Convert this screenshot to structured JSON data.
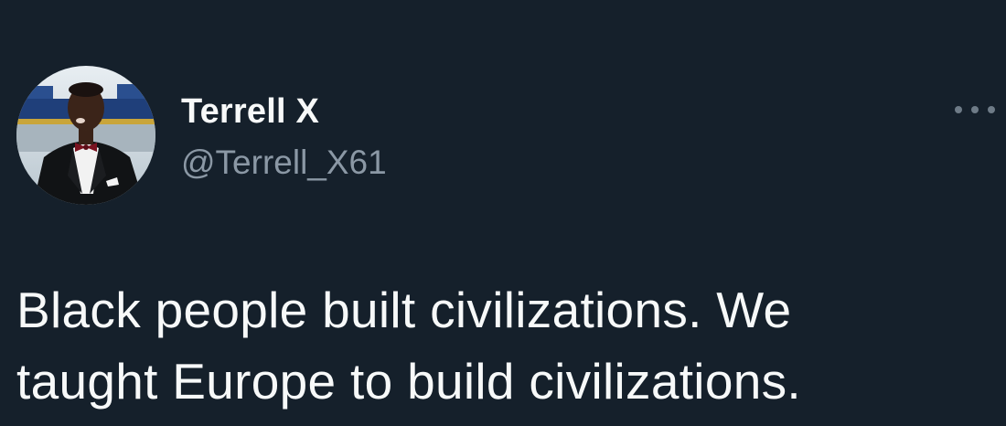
{
  "author": {
    "display_name": "Terrell X",
    "handle": "@Terrell_X61",
    "avatar_icon": "profile-photo"
  },
  "menu": {
    "icon": "more-options-icon"
  },
  "tweet": {
    "text_lines": [
      "Black people built civilizations. We",
      "taught Europe to build civilizations."
    ]
  },
  "colors": {
    "background": "#15202b",
    "primary_text": "#f7f9f9",
    "secondary_text": "#8b98a5"
  }
}
